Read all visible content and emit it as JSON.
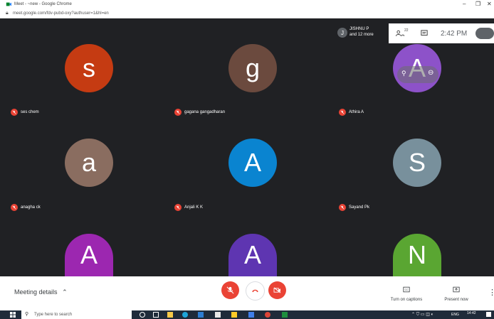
{
  "browser": {
    "title": "Meet - ~new - Google Chrome",
    "url": "meet.google.com/fdv-pubd-oxy?authuser=1&hl=en",
    "win_minimize": "–",
    "win_maximize": "❐",
    "win_close": "✕"
  },
  "meet": {
    "top_right": {
      "presenter_initial": "J",
      "presenter_name": "JISHNU P",
      "presenter_more": "and 12 more",
      "participants_count": "22",
      "time": "2:42 PM"
    },
    "tiles": [
      {
        "initial": "s",
        "name": "ses chem",
        "color": "#c53b12"
      },
      {
        "initial": "g",
        "name": "gagana gangadharan",
        "color": "#6b4a3e"
      },
      {
        "initial": "A",
        "name": "Athira A",
        "color": "#8d52c9"
      },
      {
        "initial": "a",
        "name": "anagha ck",
        "color": "#8a6d60"
      },
      {
        "initial": "A",
        "name": "Anjali K K",
        "color": "#0a84d0"
      },
      {
        "initial": "S",
        "name": "Sayand Pk",
        "color": "#78909c"
      },
      {
        "initial": "A",
        "name": "",
        "color": "#9c27b0"
      },
      {
        "initial": "A",
        "name": "",
        "color": "#5e35b1"
      },
      {
        "initial": "N",
        "name": "",
        "color": "#5aa632"
      }
    ],
    "bottom": {
      "meeting_details": "Meeting details",
      "captions_label": "Turn on captions",
      "present_label": "Present now"
    }
  },
  "taskbar": {
    "search_placeholder": "Type here to search",
    "tray_lang": "ENG",
    "tray_time": "14:42"
  }
}
